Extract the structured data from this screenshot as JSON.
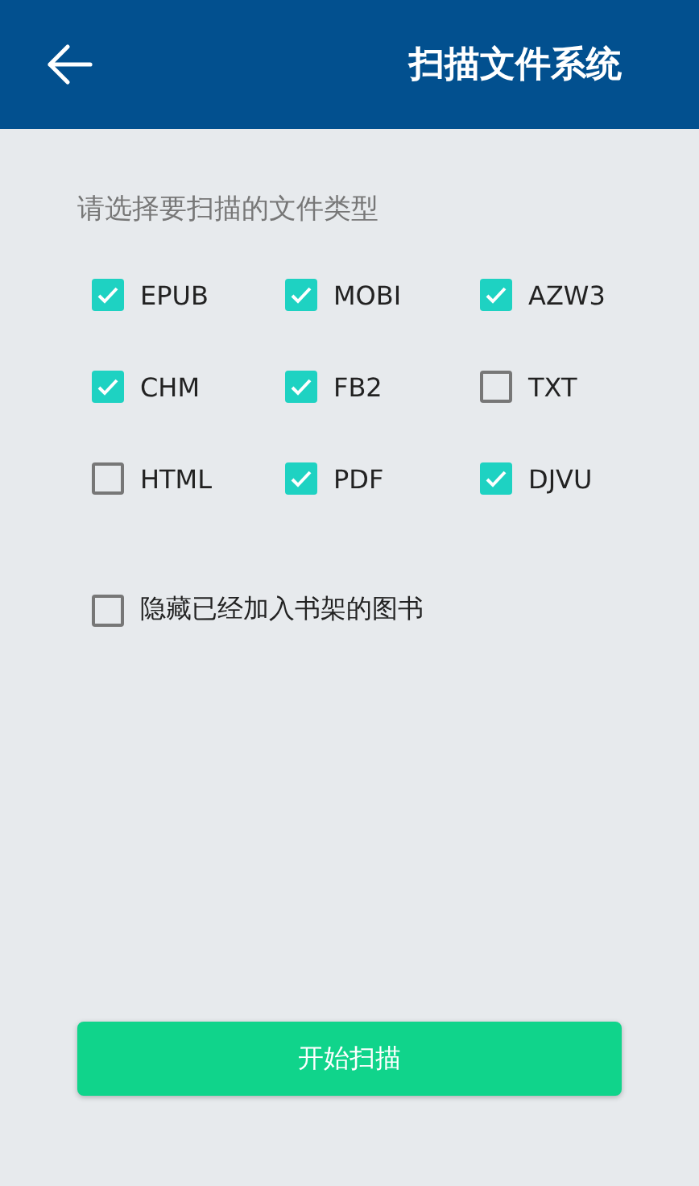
{
  "header": {
    "title": "扫描文件系统"
  },
  "prompt": "请选择要扫描的文件类型",
  "file_types": [
    {
      "label": "EPUB",
      "checked": true
    },
    {
      "label": "MOBI",
      "checked": true
    },
    {
      "label": "AZW3",
      "checked": true
    },
    {
      "label": "CHM",
      "checked": true
    },
    {
      "label": "FB2",
      "checked": true
    },
    {
      "label": "TXT",
      "checked": false
    },
    {
      "label": "HTML",
      "checked": false
    },
    {
      "label": "PDF",
      "checked": true
    },
    {
      "label": "DJVU",
      "checked": true
    }
  ],
  "hide_option": {
    "label": "隐藏已经加入书架的图书",
    "checked": false
  },
  "start_button": {
    "label": "开始扫描"
  }
}
